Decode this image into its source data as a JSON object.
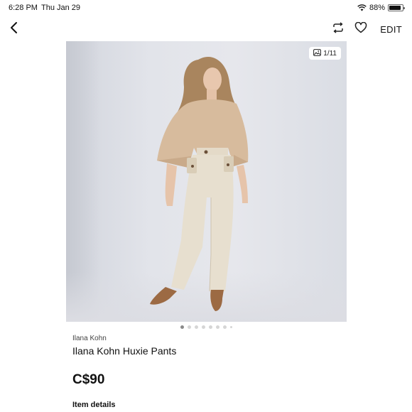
{
  "status_bar": {
    "time": "6:28 PM",
    "date": "Thu Jan 29",
    "battery_text": "88%",
    "battery_level": 0.88,
    "wifi_icon": "wifi-icon",
    "battery_icon": "battery-icon"
  },
  "nav": {
    "back_icon": "chevron-left-icon",
    "share_icon": "repost-icon",
    "like_icon": "heart-icon",
    "edit_label": "EDIT"
  },
  "photo": {
    "counter": "1/11",
    "counter_icon": "image-icon",
    "total_images": 11,
    "active_index": 1
  },
  "listing": {
    "brand": "Ilana Kohn",
    "title": "Ilana Kohn Huxie Pants",
    "price": "C$90",
    "details_heading": "Item details"
  },
  "colors": {
    "background": "#ffffff",
    "text": "#111111",
    "dot_active": "#8a8a8a",
    "dot_inactive": "#d6d6d6"
  }
}
